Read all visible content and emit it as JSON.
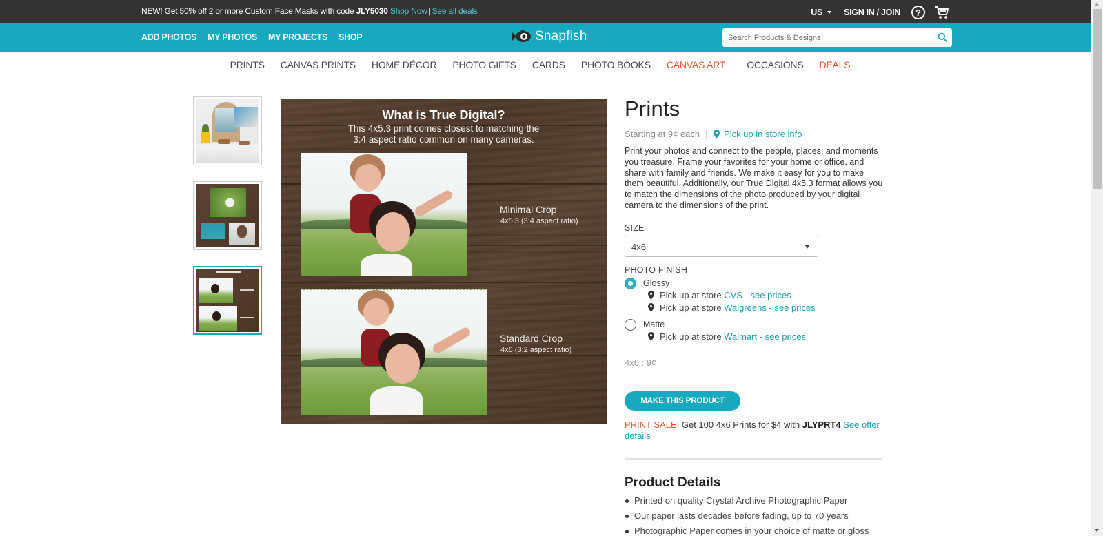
{
  "promo": {
    "text_before": "NEW! Get 50% off 2 or more Custom Face Masks with code ",
    "code": "JLY5030",
    "shop_now": "Shop Now",
    "separator": "|",
    "see_all": "See all deals"
  },
  "header": {
    "region": "US",
    "signin": "SIGN IN / JOIN",
    "help_symbol": "?",
    "icons": {
      "help": "help-circle-icon",
      "cart": "shopping-cart-icon",
      "search": "search-icon",
      "logo": "snapfish-fish-icon"
    }
  },
  "nav": {
    "links": [
      "ADD PHOTOS",
      "MY PHOTOS",
      "MY PROJECTS",
      "SHOP"
    ],
    "logo_text": "Snapfish",
    "search_placeholder": "Search Products & Designs"
  },
  "categories": {
    "items": [
      "PRINTS",
      "CANVAS PRINTS",
      "HOME DÉCOR",
      "PHOTO GIFTS",
      "CARDS",
      "PHOTO BOOKS",
      "CANVAS ART",
      "OCCASIONS",
      "DEALS"
    ],
    "accent_color": "#e0562d"
  },
  "gallery": {
    "thumbnails": [
      {
        "alt": "Prints displayed on shelf with plant",
        "active": false
      },
      {
        "alt": "Dandelion and dog prints on wood",
        "active": false
      },
      {
        "alt": "What is True Digital comparison",
        "active": true
      }
    ],
    "main_image": {
      "title": "What is True Digital?",
      "subtitle_line1": "This 4x5.3 print comes closest to matching the",
      "subtitle_line2": "3:4 aspect ratio common on many cameras.",
      "minimal_label": "Minimal Crop",
      "minimal_sub": "4x5.3 (3:4 aspect ratio)",
      "standard_label": "Standard Crop",
      "standard_sub": "4x6 (3:2 aspect ratio)"
    }
  },
  "product": {
    "title": "Prints",
    "starting_price": "Starting at 9¢ each",
    "pickup_info": "Pick up in store info",
    "description": "Print your photos and connect to the people, places, and moments you treasure. Frame your favorites for your home or office, and share with family and friends. We make it easy for you to make them beautiful. Additionally, our True Digital 4x5.3 format allows you to match the dimensions of the photo produced by your digital camera to the dimensions of the print.",
    "size_label": "SIZE",
    "size_selected": "4x6",
    "finish_label": "PHOTO FINISH",
    "finishes": [
      {
        "label": "Glossy",
        "checked": true,
        "stores": [
          {
            "prefix": "Pick up at store ",
            "store": "CVS - see prices"
          },
          {
            "prefix": "Pick up at store ",
            "store": "Walgreens - see prices"
          }
        ]
      },
      {
        "label": "Matte",
        "checked": false,
        "stores": [
          {
            "prefix": "Pick up at store ",
            "store": "Walmart - see prices"
          }
        ]
      }
    ],
    "price_summary": "4x6 : 9¢",
    "cta": "MAKE THIS PRODUCT",
    "sale": {
      "label": "PRINT SALE!",
      "text": " Get 100 4x6 Prints for $4 with ",
      "code": "JLYPRT4",
      "link": "See offer details"
    },
    "details_title": "Product Details",
    "details": [
      "Printed on quality Crystal Archive Photographic Paper",
      "Our paper lasts decades before fading, up to 70 years",
      "Photographic Paper comes in your choice of matte or gloss"
    ]
  },
  "colors": {
    "teal": "#17a9be",
    "dark_bar": "#333333",
    "accent_orange": "#e0562d",
    "link": "#1a9fb3"
  }
}
